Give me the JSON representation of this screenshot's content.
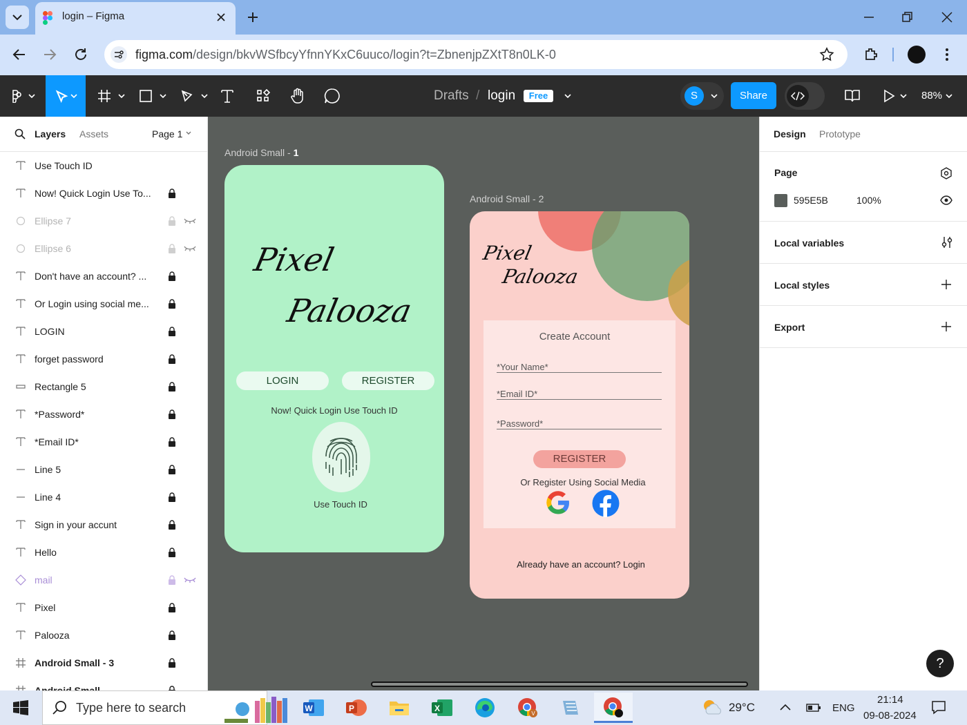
{
  "browser": {
    "tab_title": "login – Figma",
    "url_host": "figma.com",
    "url_path": "/design/bkvWSfbcyYfnnYKxC6uuco/login?t=ZbnenjpZXtT8n0LK-0"
  },
  "toolbar": {
    "breadcrumb_drafts": "Drafts",
    "breadcrumb_sep": "/",
    "file_name": "login",
    "plan_badge": "Free",
    "avatar_initial": "S",
    "share_label": "Share",
    "zoom": "88%"
  },
  "left_panel": {
    "tab_layers": "Layers",
    "tab_assets": "Assets",
    "page_selector": "Page 1",
    "layers": [
      {
        "name": "Use Touch ID",
        "icon": "text-icon",
        "locked": false,
        "hidden": false
      },
      {
        "name": "Now! Quick Login Use To...",
        "icon": "text-icon",
        "locked": true,
        "hidden": false
      },
      {
        "name": "Ellipse 7",
        "icon": "ellipse-icon",
        "locked": true,
        "hidden": true
      },
      {
        "name": "Ellipse 6",
        "icon": "ellipse-icon",
        "locked": true,
        "hidden": true
      },
      {
        "name": "Don't have an account? ...",
        "icon": "text-icon",
        "locked": true,
        "hidden": false
      },
      {
        "name": "Or Login using social me...",
        "icon": "text-icon",
        "locked": true,
        "hidden": false
      },
      {
        "name": "LOGIN",
        "icon": "text-icon",
        "locked": true,
        "hidden": false
      },
      {
        "name": "forget password",
        "icon": "text-icon",
        "locked": true,
        "hidden": false
      },
      {
        "name": "Rectangle 5",
        "icon": "rectangle-icon",
        "locked": true,
        "hidden": false
      },
      {
        "name": "*Password*",
        "icon": "text-icon",
        "locked": true,
        "hidden": false
      },
      {
        "name": "*Email ID*",
        "icon": "text-icon",
        "locked": true,
        "hidden": false
      },
      {
        "name": "Line 5",
        "icon": "line-icon",
        "locked": true,
        "hidden": false
      },
      {
        "name": "Line 4",
        "icon": "line-icon",
        "locked": true,
        "hidden": false
      },
      {
        "name": "Sign in your accunt",
        "icon": "text-icon",
        "locked": true,
        "hidden": false
      },
      {
        "name": "Hello",
        "icon": "text-icon",
        "locked": true,
        "hidden": false
      },
      {
        "name": "mail",
        "icon": "component-icon",
        "locked": true,
        "hidden": true
      },
      {
        "name": "Pixel",
        "icon": "text-icon",
        "locked": true,
        "hidden": false
      },
      {
        "name": "Palooza",
        "icon": "text-icon",
        "locked": true,
        "hidden": false
      },
      {
        "name": "Android Small - 3",
        "icon": "frame-icon",
        "locked": true,
        "hidden": false
      },
      {
        "name": "Android Small",
        "icon": "frame-icon",
        "locked": true,
        "hidden": false
      }
    ]
  },
  "canvas": {
    "background": "#5A5E5B",
    "frame1": {
      "label_prefix": "Android Small - ",
      "label_num": "1",
      "logo_line1": "Pixel",
      "logo_line2": "Palooza",
      "login_btn": "LOGIN",
      "register_btn": "REGISTER",
      "quick_login": "Now! Quick Login Use Touch ID",
      "touch_id": "Use Touch ID",
      "bg": "#B1F2C8"
    },
    "frame2": {
      "label": "Android Small - 2",
      "logo_line1": "Pixel",
      "logo_line2": "Palooza",
      "heading": "Create Account",
      "name_placeholder": "*Your Name*",
      "email_placeholder": "*Email ID*",
      "password_placeholder": "*Password*",
      "register_btn": "REGISTER",
      "social_text": "Or Register Using Social Media",
      "already": "Already have an account? Login",
      "bg": "#FBD0CB"
    }
  },
  "right_panel": {
    "tab_design": "Design",
    "tab_prototype": "Prototype",
    "page_title": "Page",
    "page_color_hex": "595E5B",
    "page_opacity": "100%",
    "local_variables": "Local variables",
    "local_styles": "Local styles",
    "export": "Export"
  },
  "taskbar": {
    "search_placeholder": "Type here to search",
    "weather_temp": "29°C",
    "language": "ENG",
    "time": "21:14",
    "date": "09-08-2024"
  }
}
